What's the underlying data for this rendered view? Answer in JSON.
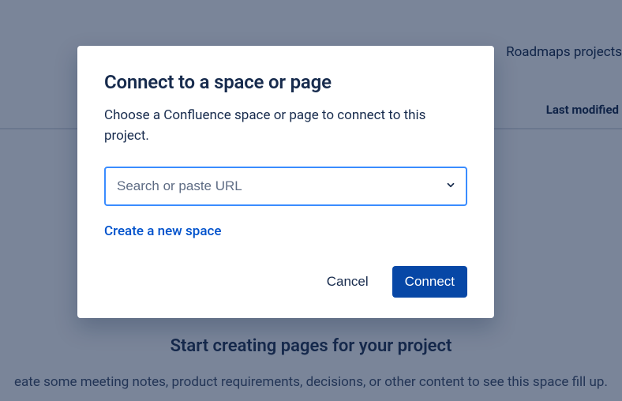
{
  "background": {
    "roadmaps_text": "Roadmaps projects",
    "last_modified_label": "Last modified",
    "empty_heading": "Start creating pages for your project",
    "empty_body": "eate some meeting notes, product requirements, decisions, or other content to see this space fill up."
  },
  "dialog": {
    "title": "Connect to a space or page",
    "description": "Choose a Confluence space or page to connect to this project.",
    "search_placeholder": "Search or paste URL",
    "search_value": "",
    "create_link": "Create a new space",
    "cancel_label": "Cancel",
    "connect_label": "Connect"
  }
}
